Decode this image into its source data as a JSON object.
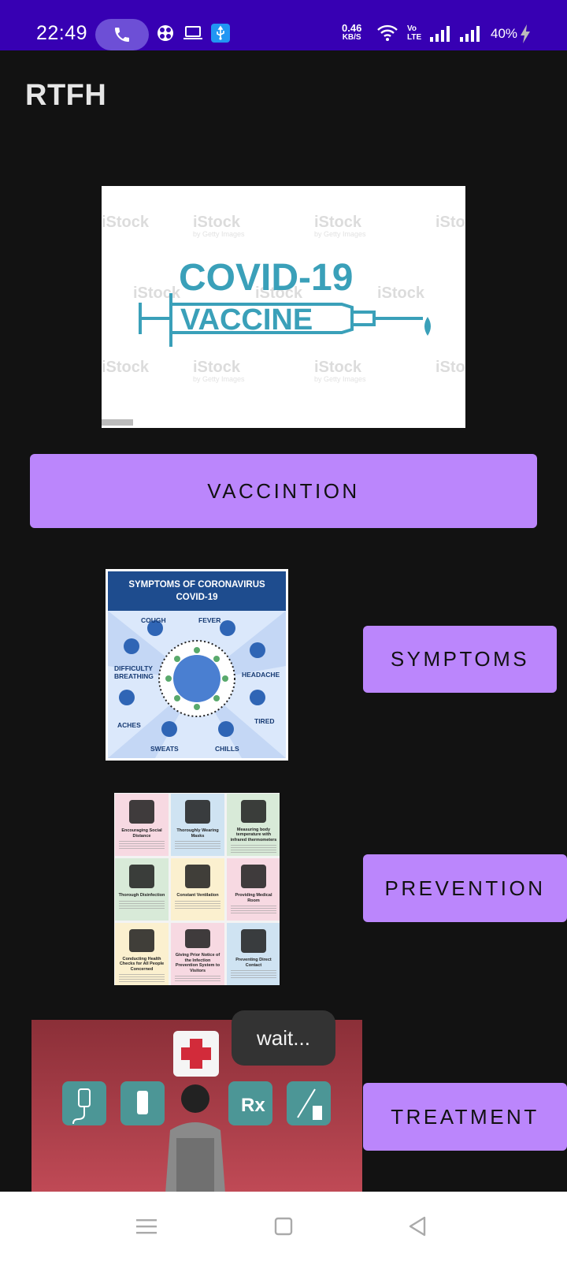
{
  "status_bar": {
    "time": "22:49",
    "net_speed_value": "0.46",
    "net_speed_unit": "KB/S",
    "volte_line1": "Vo",
    "volte_line2": "LTE",
    "battery": "40%"
  },
  "app_bar": {
    "title": "RTFH"
  },
  "vaccination": {
    "image_alt": "COVID-19 VACCINE",
    "image_line1": "COVID-19",
    "image_line2": "VACCINE",
    "watermark": "iStock",
    "watermark_sub": "by Getty Images",
    "button_label": "VACCINTION"
  },
  "symptoms": {
    "image_title": "SYMPTOMS OF CORONAVIRUS COVID-19",
    "image_title_line1": "SYMPTOMS OF CORONAVIRUS",
    "image_title_line2": "COVID-19",
    "labels": {
      "cough": "COUGH",
      "fever": "FEVER",
      "breathing1": "DIFFICULTY",
      "breathing2": "BREATHING",
      "headache": "HEADACHE",
      "aches": "ACHES",
      "tired": "TIRED",
      "sweats": "SWEATS",
      "chills": "CHILLS"
    },
    "button_label": "SYMPTOMS"
  },
  "prevention": {
    "tiles": [
      {
        "title": "Encouraging Social Distance",
        "bg": "#f7d9e2"
      },
      {
        "title": "Thoroughly Wearing Masks",
        "bg": "#cfe3f2"
      },
      {
        "title": "Measuring body temperature with infrared thermometers",
        "bg": "#d8ead8"
      },
      {
        "title": "Thorough Disinfection",
        "bg": "#d8ead8"
      },
      {
        "title": "Constant Ventilation",
        "bg": "#fbf0cf"
      },
      {
        "title": "Providing Medical Room",
        "bg": "#f7d9e2"
      },
      {
        "title": "Conducting Health Checks for All People Concerned",
        "bg": "#fbf0cf"
      },
      {
        "title": "Giving Prior Notice of the Infection Prevention System to Visitors",
        "bg": "#f7d9e2"
      },
      {
        "title": "Preventing Direct Contact",
        "bg": "#cfe3f2"
      }
    ],
    "button_label": "PREVENTION"
  },
  "treatment": {
    "rx": "Rx",
    "button_label": "TREATMENT"
  },
  "toast": {
    "text": "wait..."
  },
  "colors": {
    "status_bar": "#3700b3",
    "background": "#121212",
    "button": "#bb86fc",
    "vaccine_teal": "#3aa0b9"
  }
}
